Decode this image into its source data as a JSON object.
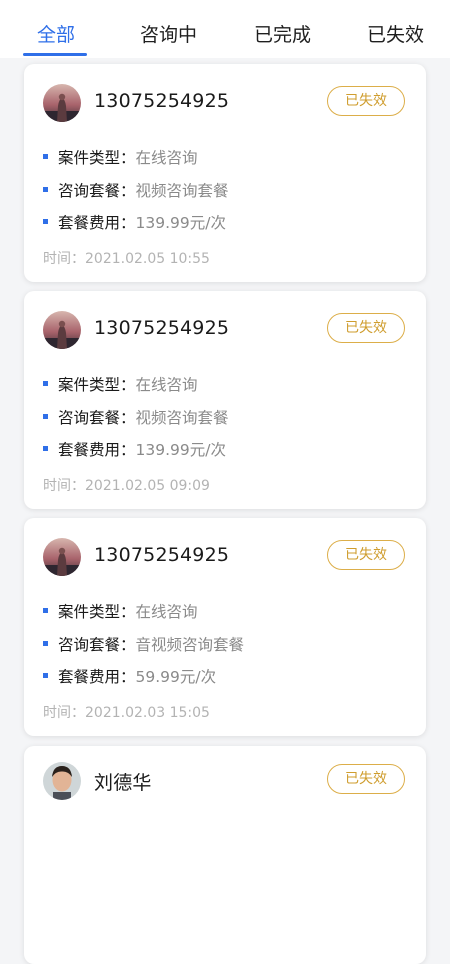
{
  "tabs": [
    {
      "label": "全部",
      "active": true
    },
    {
      "label": "咨询中",
      "active": false
    },
    {
      "label": "已完成",
      "active": false
    },
    {
      "label": "已失效",
      "active": false
    }
  ],
  "colors": {
    "accent": "#2f6fe8",
    "badge": "#cf9d2e",
    "muted_text": "#8a8a8a",
    "time_text": "#b3b3b3"
  },
  "orders": [
    {
      "avatar": "avatar-photo",
      "name": "13075254925",
      "status": "已失效",
      "fields": [
        {
          "label": "案件类型：",
          "value": "在线咨询"
        },
        {
          "label": "咨询套餐：",
          "value": "视频咨询套餐"
        },
        {
          "label": "套餐费用：",
          "value": "139.99元/次"
        }
      ],
      "time": "时间：2021.02.05 10:55"
    },
    {
      "avatar": "avatar-photo",
      "name": "13075254925",
      "status": "已失效",
      "fields": [
        {
          "label": "案件类型：",
          "value": "在线咨询"
        },
        {
          "label": "咨询套餐：",
          "value": "视频咨询套餐"
        },
        {
          "label": "套餐费用：",
          "value": "139.99元/次"
        }
      ],
      "time": "时间：2021.02.05 09:09"
    },
    {
      "avatar": "avatar-photo",
      "name": "13075254925",
      "status": "已失效",
      "fields": [
        {
          "label": "案件类型：",
          "value": "在线咨询"
        },
        {
          "label": "咨询套餐：",
          "value": "音视频咨询套餐"
        },
        {
          "label": "套餐费用：",
          "value": "59.99元/次"
        }
      ],
      "time": "时间：2021.02.03 15:05"
    },
    {
      "avatar": "avatar-person",
      "name": "刘德华",
      "status": "已失效",
      "fields": [],
      "time": ""
    }
  ]
}
